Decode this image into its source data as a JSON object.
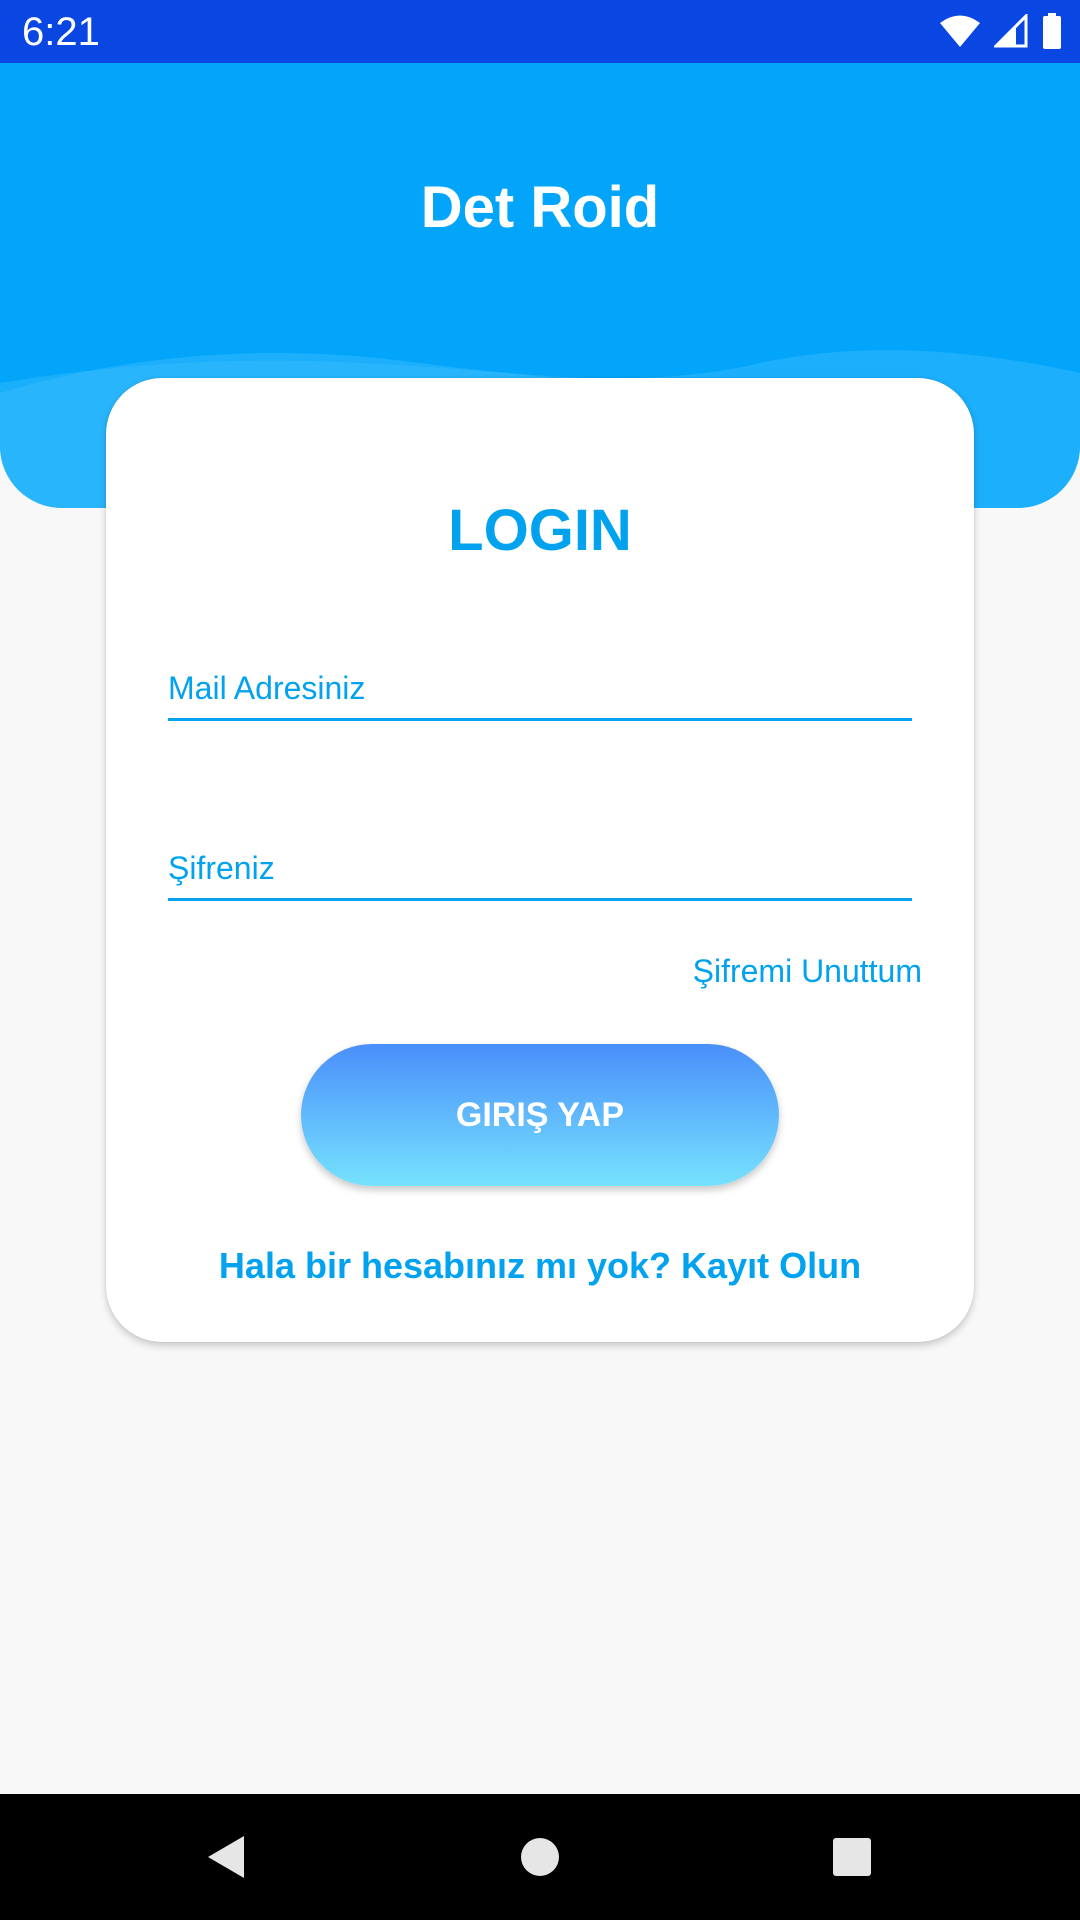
{
  "status_bar": {
    "time": "6:21",
    "icons": [
      "wifi-icon",
      "cellular-signal-icon",
      "battery-icon"
    ]
  },
  "header": {
    "app_title": "Det Roid"
  },
  "card": {
    "title": "LOGIN",
    "email_placeholder": "Mail Adresiniz",
    "password_placeholder": "Şifreniz",
    "forgot_password": "Şifremi Unuttum",
    "login_button": "GIRIŞ YAP",
    "register_prompt": "Hala bir hesabınız mı yok? Kayıt Olun"
  },
  "nav_bar": {
    "icons": [
      "back-icon",
      "home-icon",
      "recents-icon"
    ]
  },
  "colors": {
    "status_bar": "#0a47e2",
    "header": "#03a5fb",
    "accent": "#03a2ef",
    "button_gradient_top": "#4a8ffb",
    "button_gradient_bottom": "#76e2fd",
    "background": "#f8f8f8"
  }
}
